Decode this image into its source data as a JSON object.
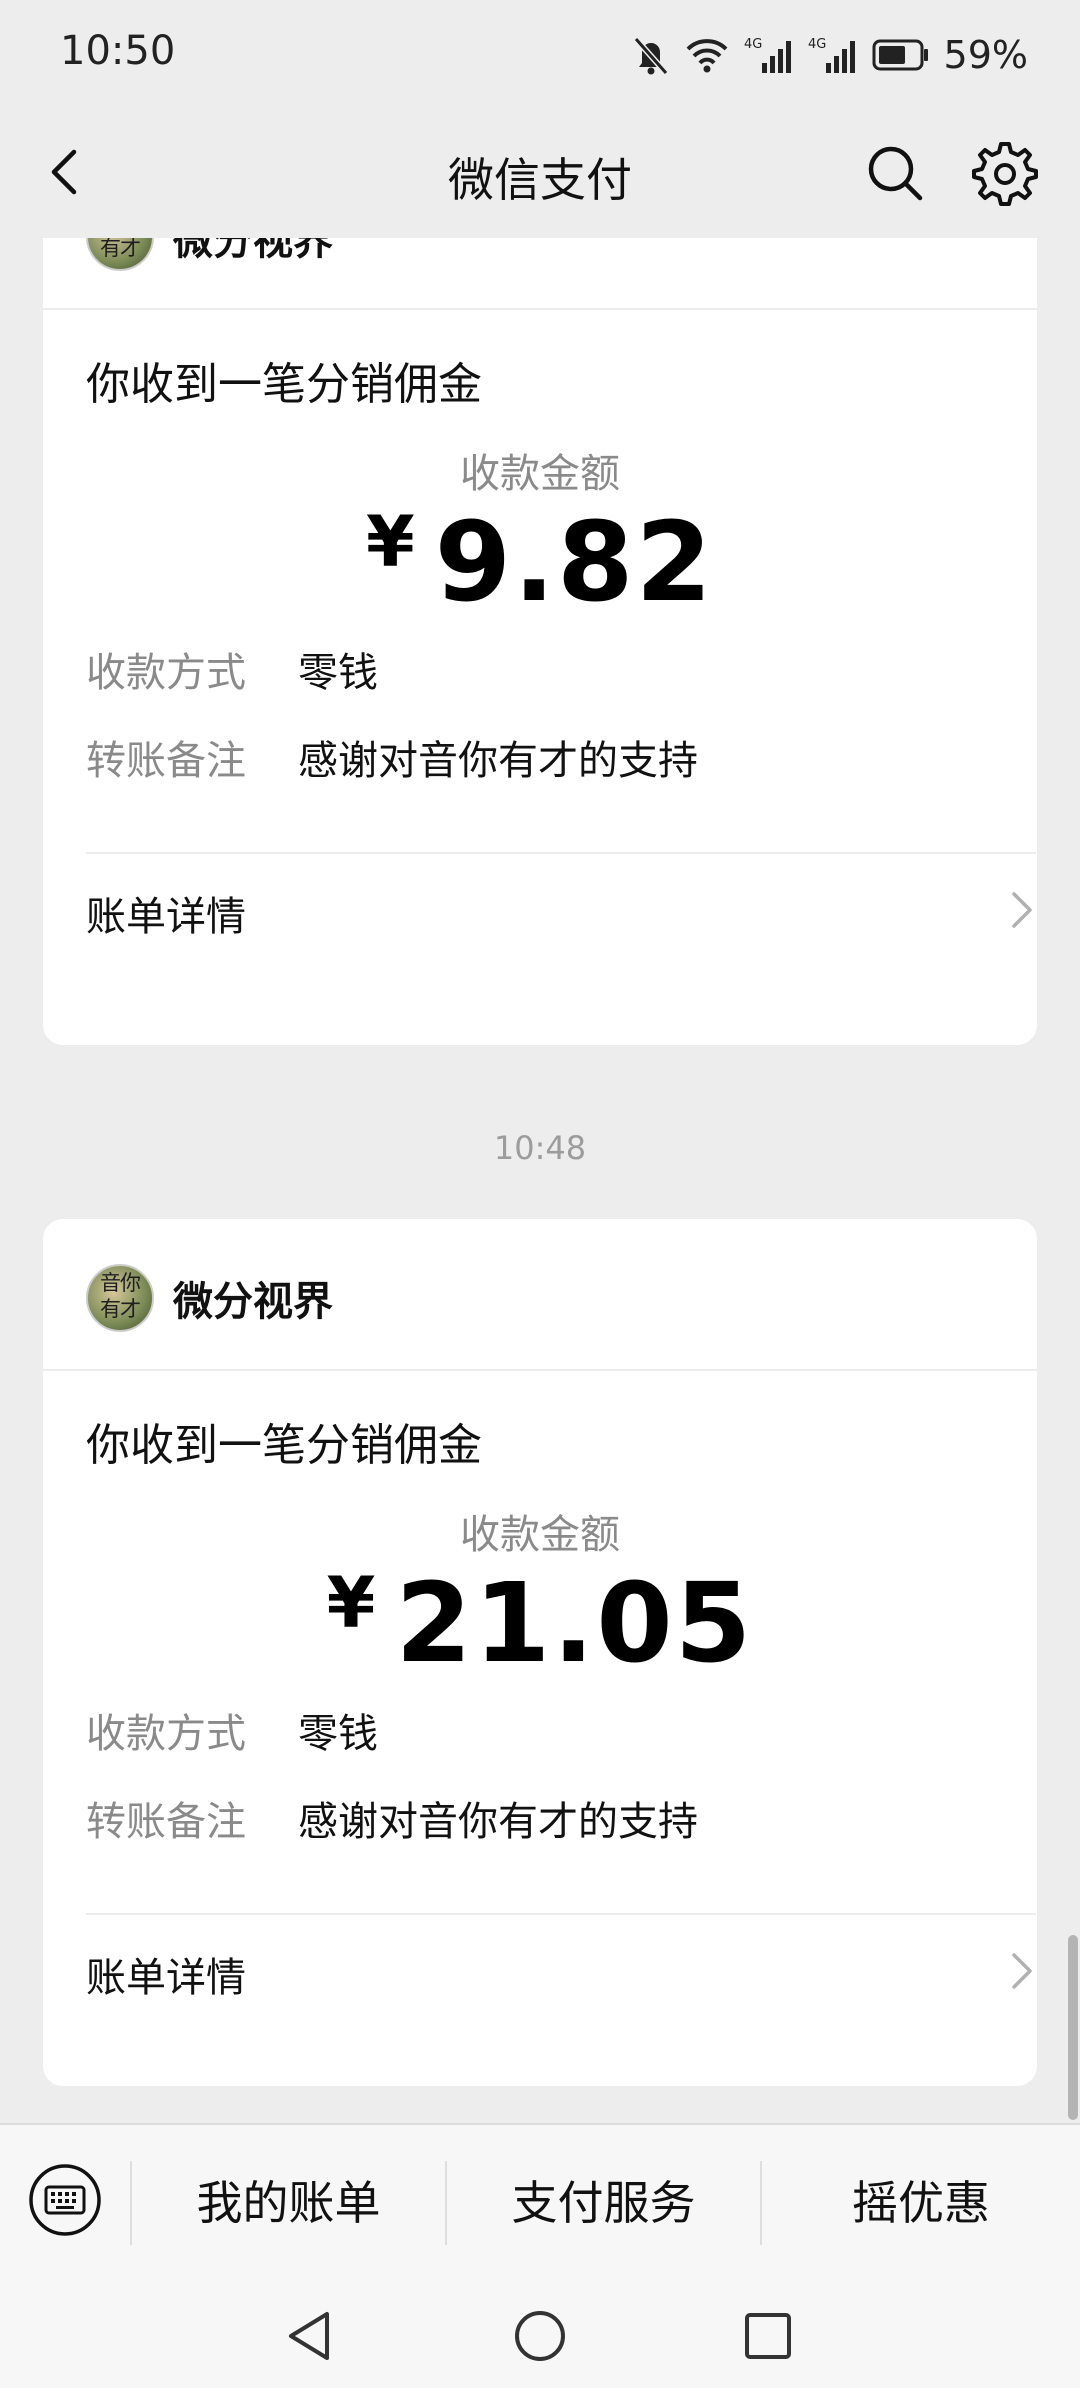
{
  "status_bar": {
    "time": "10:50",
    "battery": "59%"
  },
  "nav": {
    "title": "微信支付"
  },
  "cards": [
    {
      "merchant": "微分视界",
      "avatar_text": "音你有才",
      "title": "你收到一笔分销佣金",
      "amount_label": "收款金额",
      "currency": "¥",
      "amount": "9.82",
      "method_label": "收款方式",
      "method_value": "零钱",
      "note_label": "转账备注",
      "note_value": "感谢对音你有才的支持",
      "detail_label": "账单详情"
    },
    {
      "timestamp": "10:48",
      "merchant": "微分视界",
      "avatar_text": "音你有才",
      "title": "你收到一笔分销佣金",
      "amount_label": "收款金额",
      "currency": "¥",
      "amount": "21.05",
      "method_label": "收款方式",
      "method_value": "零钱",
      "note_label": "转账备注",
      "note_value": "感谢对音你有才的支持",
      "detail_label": "账单详情"
    }
  ],
  "bottom_menu": [
    "我的账单",
    "支付服务",
    "摇优惠"
  ]
}
